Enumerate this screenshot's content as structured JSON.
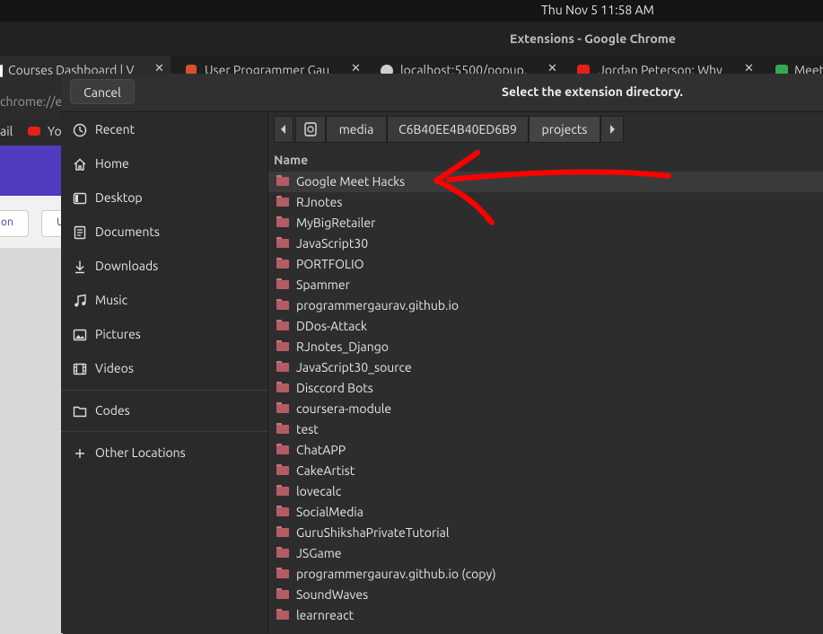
{
  "topbar": {
    "clock": "Thu Nov 5  11:58 AM"
  },
  "window": {
    "title": "Extensions - Google Chrome"
  },
  "tabs": [
    {
      "label": "Courses Dashboard | V",
      "favicon_color": "#ffffff"
    },
    {
      "label": "User Programmer Gau",
      "favicon_color": "#d94f2b"
    },
    {
      "label": "localhost:5500/popup.",
      "favicon_color": "#cfcfcf"
    },
    {
      "label": "Jordan Peterson: Why",
      "favicon_color": "#e62117"
    },
    {
      "label": "Meet",
      "favicon_color": "#34a853"
    }
  ],
  "address_bar": {
    "text": "chrome://ext"
  },
  "bookmarks": {
    "item1": "ail",
    "item2": "Yo"
  },
  "page": {
    "button1": "on",
    "button2": "U"
  },
  "dialog": {
    "cancel_label": "Cancel",
    "title": "Select the extension directory.",
    "sidebar": [
      {
        "label": "Recent",
        "icon": "clock-icon"
      },
      {
        "label": "Home",
        "icon": "home-icon"
      },
      {
        "label": "Desktop",
        "icon": "desktop-icon"
      },
      {
        "label": "Documents",
        "icon": "document-icon"
      },
      {
        "label": "Downloads",
        "icon": "download-icon"
      },
      {
        "label": "Music",
        "icon": "music-icon"
      },
      {
        "label": "Pictures",
        "icon": "picture-icon"
      },
      {
        "label": "Videos",
        "icon": "video-icon"
      },
      {
        "label": "Codes",
        "icon": "folder-icon"
      },
      {
        "label": "Other Locations",
        "icon": "plus-icon"
      }
    ],
    "path": [
      "media",
      "C6B40EE4B40ED6B9",
      "projects"
    ],
    "column_name": "Name",
    "files": [
      "Google Meet Hacks",
      "RJnotes",
      "MyBigRetailer",
      "JavaScript30",
      "PORTFOLIO",
      "Spammer",
      "programmergaurav.github.io",
      "DDos-Attack",
      "RJnotes_Django",
      "JavaScript30_source",
      "Disccord Bots",
      "coursera-module",
      "test",
      "ChatAPP",
      "CakeArtist",
      "lovecalc",
      "SocialMedia",
      "GuruShikshaPrivateTutorial",
      "JSGame",
      "programmergaurav.github.io (copy)",
      "SoundWaves",
      "learnreact"
    ],
    "selected_index": 0,
    "annotation_color": "#ff0000"
  }
}
